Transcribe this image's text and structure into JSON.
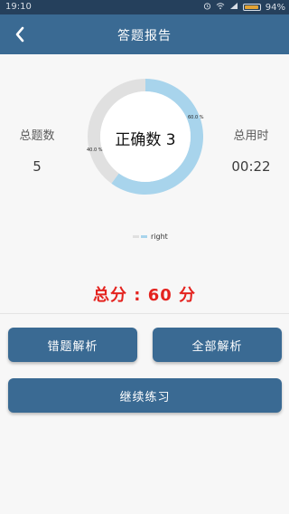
{
  "status_bar": {
    "time": "19:10",
    "battery_percent": "94%",
    "battery_level": 0.94,
    "icons": [
      "alarm-icon",
      "wifi-icon",
      "signal-icon",
      "battery-icon"
    ]
  },
  "header": {
    "title": "答题报告",
    "back_icon": "chevron-left-icon"
  },
  "stats": {
    "total_label": "总题数",
    "total_value": "5",
    "time_label": "总用时",
    "time_value": "00:22"
  },
  "chart_data": {
    "type": "pie",
    "center_text": "正确数 3",
    "slices": [
      {
        "label": "60.0 %",
        "value": 60.0,
        "color": "#a8d4ec"
      },
      {
        "label": "40.0 %",
        "value": 40.0,
        "color": "#e0e0e0"
      }
    ],
    "legend": [
      {
        "name": "right"
      }
    ],
    "legend_placement": "bottom-center"
  },
  "score": {
    "text": "总分 : 60 分"
  },
  "buttons": {
    "wrong_analysis": "错题解析",
    "all_analysis": "全部解析",
    "continue": "继续练习"
  },
  "colors": {
    "primary": "#3a6a93",
    "score": "#e4231f",
    "correct_slice": "#a8d4ec",
    "other_slice": "#e0e0e0"
  }
}
